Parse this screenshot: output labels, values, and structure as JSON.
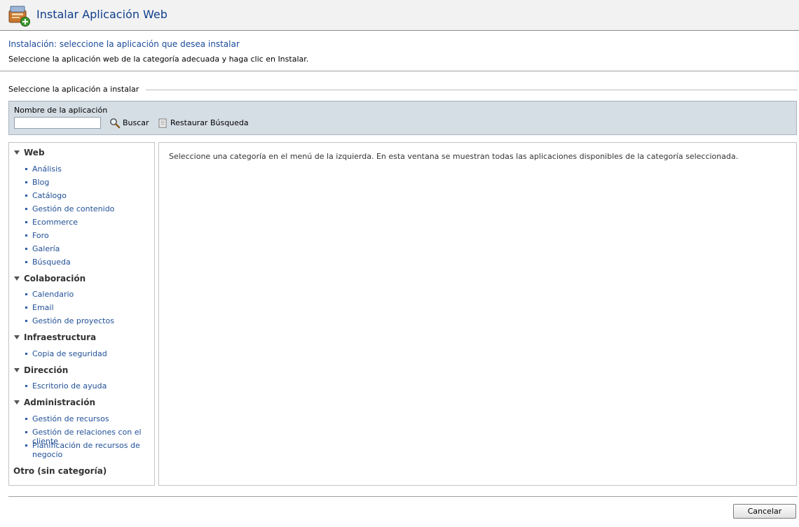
{
  "header": {
    "title": "Instalar Aplicación Web"
  },
  "intro": {
    "step_title": "Instalación: seleccione la aplicación que desea instalar",
    "description": "Seleccione la aplicación web de la categoría adecuada y haga clic en Instalar."
  },
  "selector": {
    "legend": "Seleccione la aplicación a instalar",
    "search_label": "Nombre de la aplicación",
    "search_value": "",
    "search_button": "Buscar",
    "reset_button": "Restaurar Búsqueda"
  },
  "categories": [
    {
      "label": "Web",
      "items": [
        "Análisis",
        "Blog",
        "Catálogo",
        "Gestión de contenido",
        "Ecommerce",
        "Foro",
        "Galería",
        "Búsqueda"
      ]
    },
    {
      "label": "Colaboración",
      "items": [
        "Calendario",
        "Email",
        "Gestión de proyectos"
      ]
    },
    {
      "label": "Infraestructura",
      "items": [
        "Copia de seguridad"
      ]
    },
    {
      "label": "Dirección",
      "items": [
        "Escritorio de ayuda"
      ]
    },
    {
      "label": "Administración",
      "items": [
        "Gestión de recursos",
        "Gestión de relaciones con el cliente",
        "Planificación de recursos de negocio"
      ]
    },
    {
      "label": "Otro (sin categoría)",
      "items": []
    }
  ],
  "content": {
    "message": "Seleccione una categoría en el menú de la izquierda. En esta ventana se muestran todas las aplicaciones disponibles de la categoría seleccionada."
  },
  "footer": {
    "cancel_label": "Cancelar"
  }
}
